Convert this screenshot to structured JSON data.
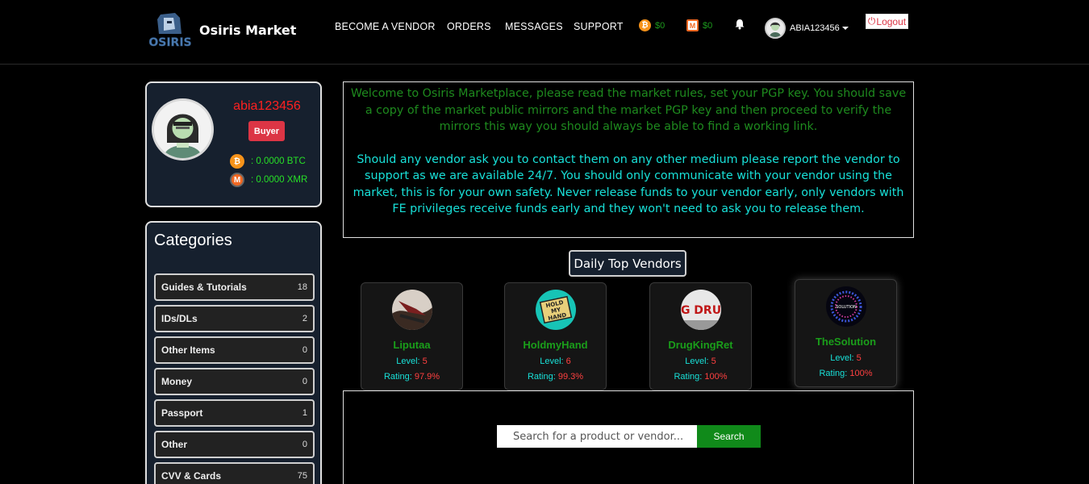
{
  "header": {
    "brand_name": "Osiris Market",
    "logo_text": "OSIRIS",
    "nav": [
      "BECOME A VENDOR",
      "ORDERS",
      "MESSAGES",
      "SUPPORT"
    ],
    "btc_balance": "$0",
    "xmr_balance": "$0",
    "username": "ABIA123456",
    "logout": "Logout"
  },
  "profile": {
    "username": "abia123456",
    "role": "Buyer",
    "btc": ": 0.0000 BTC",
    "xmr": ": 0.0000 XMR"
  },
  "categories": {
    "title": "Categories",
    "items": [
      {
        "name": "Guides & Tutorials",
        "count": "18"
      },
      {
        "name": "IDs/DLs",
        "count": "2"
      },
      {
        "name": "Other Items",
        "count": "0"
      },
      {
        "name": "Money",
        "count": "0"
      },
      {
        "name": "Passport",
        "count": "1"
      },
      {
        "name": "Other",
        "count": "0"
      },
      {
        "name": "CVV & Cards",
        "count": "75"
      }
    ]
  },
  "welcome": {
    "para1": "Welcome to Osiris Marketplace, please read the market rules, set your PGP key. You should save a copy of the market public mirrors and the market PGP key and then proceed to verify the mirrors this way you should always be able to find a working link.",
    "para2": "Should any vendor ask you to contact them on any other medium please report the vendor to support as we are available 24/7. You should only communicate with your vendor using the market, this is for your own safety. Never release funds to your vendor early, only vendors with FE privileges receive funds early and they won't need to ask you to release them."
  },
  "top_vendors": {
    "title": "Daily Top Vendors",
    "level_label": "Level: ",
    "rating_label": "Rating: ",
    "items": [
      {
        "name": "Liputaa",
        "level": "5",
        "rating": "97.9%"
      },
      {
        "name": "HoldmyHand",
        "level": "6",
        "rating": "99.3%",
        "avatar_text": [
          "HOLD",
          "MY",
          "HAND"
        ]
      },
      {
        "name": "DrugKingRet",
        "level": "5",
        "rating": "100%",
        "avatar_text": "G DRU"
      },
      {
        "name": "TheSolution",
        "level": "5",
        "rating": "100%",
        "avatar_text": "SOLUTION"
      }
    ]
  },
  "search": {
    "placeholder": "Search for a product or vendor...",
    "button": "Search"
  },
  "colors": {
    "background": "#000000",
    "card": "#16202e",
    "green": "#1a9e1a",
    "cyan": "#18e0d8",
    "red": "#dc3545",
    "btc": "#f7931a",
    "xmr": "#f26822"
  }
}
